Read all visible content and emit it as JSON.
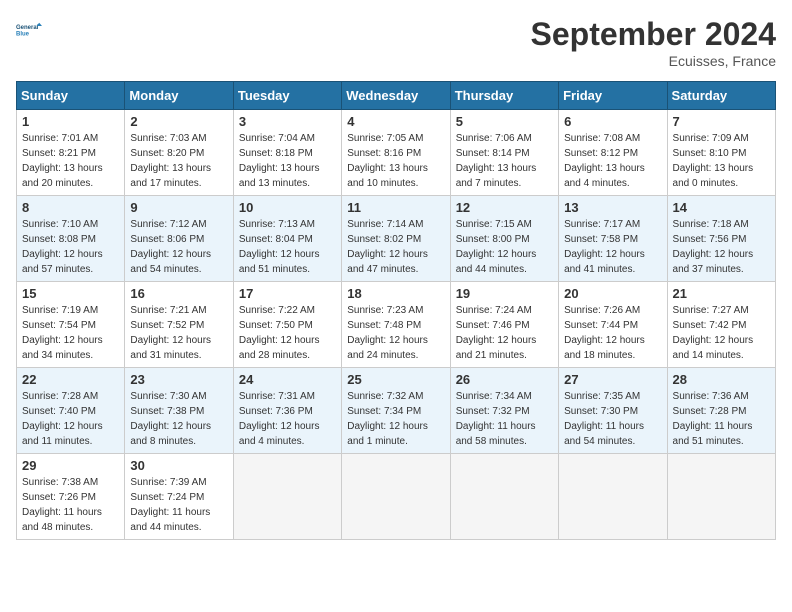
{
  "header": {
    "logo_line1": "General",
    "logo_line2": "Blue",
    "month": "September 2024",
    "location": "Ecuisses, France"
  },
  "weekdays": [
    "Sunday",
    "Monday",
    "Tuesday",
    "Wednesday",
    "Thursday",
    "Friday",
    "Saturday"
  ],
  "weeks": [
    [
      {
        "day": "1",
        "sunrise": "7:01 AM",
        "sunset": "8:21 PM",
        "daylight": "13 hours and 20 minutes."
      },
      {
        "day": "2",
        "sunrise": "7:03 AM",
        "sunset": "8:20 PM",
        "daylight": "13 hours and 17 minutes."
      },
      {
        "day": "3",
        "sunrise": "7:04 AM",
        "sunset": "8:18 PM",
        "daylight": "13 hours and 13 minutes."
      },
      {
        "day": "4",
        "sunrise": "7:05 AM",
        "sunset": "8:16 PM",
        "daylight": "13 hours and 10 minutes."
      },
      {
        "day": "5",
        "sunrise": "7:06 AM",
        "sunset": "8:14 PM",
        "daylight": "13 hours and 7 minutes."
      },
      {
        "day": "6",
        "sunrise": "7:08 AM",
        "sunset": "8:12 PM",
        "daylight": "13 hours and 4 minutes."
      },
      {
        "day": "7",
        "sunrise": "7:09 AM",
        "sunset": "8:10 PM",
        "daylight": "13 hours and 0 minutes."
      }
    ],
    [
      {
        "day": "8",
        "sunrise": "7:10 AM",
        "sunset": "8:08 PM",
        "daylight": "12 hours and 57 minutes."
      },
      {
        "day": "9",
        "sunrise": "7:12 AM",
        "sunset": "8:06 PM",
        "daylight": "12 hours and 54 minutes."
      },
      {
        "day": "10",
        "sunrise": "7:13 AM",
        "sunset": "8:04 PM",
        "daylight": "12 hours and 51 minutes."
      },
      {
        "day": "11",
        "sunrise": "7:14 AM",
        "sunset": "8:02 PM",
        "daylight": "12 hours and 47 minutes."
      },
      {
        "day": "12",
        "sunrise": "7:15 AM",
        "sunset": "8:00 PM",
        "daylight": "12 hours and 44 minutes."
      },
      {
        "day": "13",
        "sunrise": "7:17 AM",
        "sunset": "7:58 PM",
        "daylight": "12 hours and 41 minutes."
      },
      {
        "day": "14",
        "sunrise": "7:18 AM",
        "sunset": "7:56 PM",
        "daylight": "12 hours and 37 minutes."
      }
    ],
    [
      {
        "day": "15",
        "sunrise": "7:19 AM",
        "sunset": "7:54 PM",
        "daylight": "12 hours and 34 minutes."
      },
      {
        "day": "16",
        "sunrise": "7:21 AM",
        "sunset": "7:52 PM",
        "daylight": "12 hours and 31 minutes."
      },
      {
        "day": "17",
        "sunrise": "7:22 AM",
        "sunset": "7:50 PM",
        "daylight": "12 hours and 28 minutes."
      },
      {
        "day": "18",
        "sunrise": "7:23 AM",
        "sunset": "7:48 PM",
        "daylight": "12 hours and 24 minutes."
      },
      {
        "day": "19",
        "sunrise": "7:24 AM",
        "sunset": "7:46 PM",
        "daylight": "12 hours and 21 minutes."
      },
      {
        "day": "20",
        "sunrise": "7:26 AM",
        "sunset": "7:44 PM",
        "daylight": "12 hours and 18 minutes."
      },
      {
        "day": "21",
        "sunrise": "7:27 AM",
        "sunset": "7:42 PM",
        "daylight": "12 hours and 14 minutes."
      }
    ],
    [
      {
        "day": "22",
        "sunrise": "7:28 AM",
        "sunset": "7:40 PM",
        "daylight": "12 hours and 11 minutes."
      },
      {
        "day": "23",
        "sunrise": "7:30 AM",
        "sunset": "7:38 PM",
        "daylight": "12 hours and 8 minutes."
      },
      {
        "day": "24",
        "sunrise": "7:31 AM",
        "sunset": "7:36 PM",
        "daylight": "12 hours and 4 minutes."
      },
      {
        "day": "25",
        "sunrise": "7:32 AM",
        "sunset": "7:34 PM",
        "daylight": "12 hours and 1 minute."
      },
      {
        "day": "26",
        "sunrise": "7:34 AM",
        "sunset": "7:32 PM",
        "daylight": "11 hours and 58 minutes."
      },
      {
        "day": "27",
        "sunrise": "7:35 AM",
        "sunset": "7:30 PM",
        "daylight": "11 hours and 54 minutes."
      },
      {
        "day": "28",
        "sunrise": "7:36 AM",
        "sunset": "7:28 PM",
        "daylight": "11 hours and 51 minutes."
      }
    ],
    [
      {
        "day": "29",
        "sunrise": "7:38 AM",
        "sunset": "7:26 PM",
        "daylight": "11 hours and 48 minutes."
      },
      {
        "day": "30",
        "sunrise": "7:39 AM",
        "sunset": "7:24 PM",
        "daylight": "11 hours and 44 minutes."
      },
      null,
      null,
      null,
      null,
      null
    ]
  ]
}
